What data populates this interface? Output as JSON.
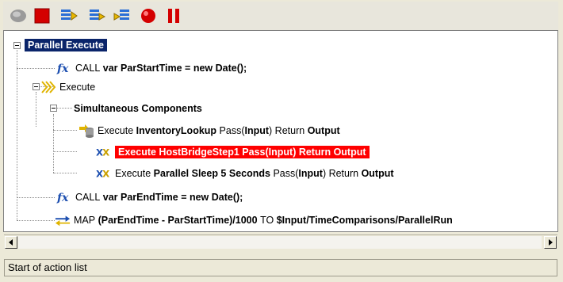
{
  "toolbar": {
    "buttons": [
      {
        "icon": "record-gray-icon"
      },
      {
        "icon": "stop-icon"
      },
      {
        "icon": "step-into-icon"
      },
      {
        "icon": "step-over-icon"
      },
      {
        "icon": "step-out-icon"
      },
      {
        "icon": "breakpoint-icon"
      },
      {
        "icon": "pause-icon"
      }
    ]
  },
  "tree": {
    "root": "Parallel Execute",
    "call1": {
      "prefix": "CALL",
      "expr": "var ParStartTime = new Date();"
    },
    "execute": "Execute",
    "simultaneous": "Simultaneous Components",
    "inv": {
      "a": "Execute",
      "b": "InventoryLookup",
      "c": "Pass(",
      "d": "Input",
      "e": ") Return",
      "f": "Output"
    },
    "host": "Execute HostBridgeStep1 Pass(Input) Return Output",
    "sleep": {
      "a": "Execute",
      "b": "Parallel Sleep 5 Seconds",
      "c": "Pass(",
      "d": "Input",
      "e": ") Return",
      "f": "Output"
    },
    "call2": {
      "prefix": "CALL",
      "expr": "var ParEndTime = new Date();"
    },
    "map": {
      "a": "MAP",
      "b": "(ParEndTime - ParStartTime)/1000",
      "c": "TO",
      "d": "$Input/TimeComparisons/ParallelRun"
    }
  },
  "status": {
    "text": "Start of action list"
  },
  "colors": {
    "selection_blue": "#0a246a",
    "highlight_red": "#ff0000"
  }
}
